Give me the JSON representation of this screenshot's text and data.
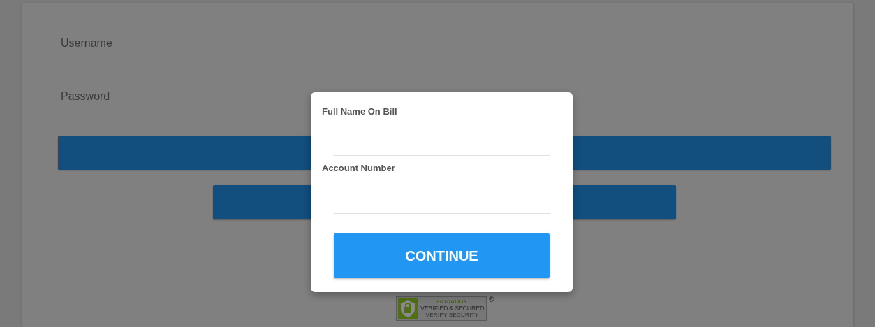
{
  "login": {
    "username": {
      "placeholder": "Username"
    },
    "password": {
      "placeholder": "Password"
    }
  },
  "badge": {
    "brand": "GODADDY",
    "title": "VERIFIED & SECURED",
    "subtitle": "VERIFY SECURITY",
    "mark": "®"
  },
  "dialog": {
    "fields": [
      {
        "label": "Full Name On Bill"
      },
      {
        "label": "Account Number"
      }
    ],
    "button": "CONTINUE"
  }
}
